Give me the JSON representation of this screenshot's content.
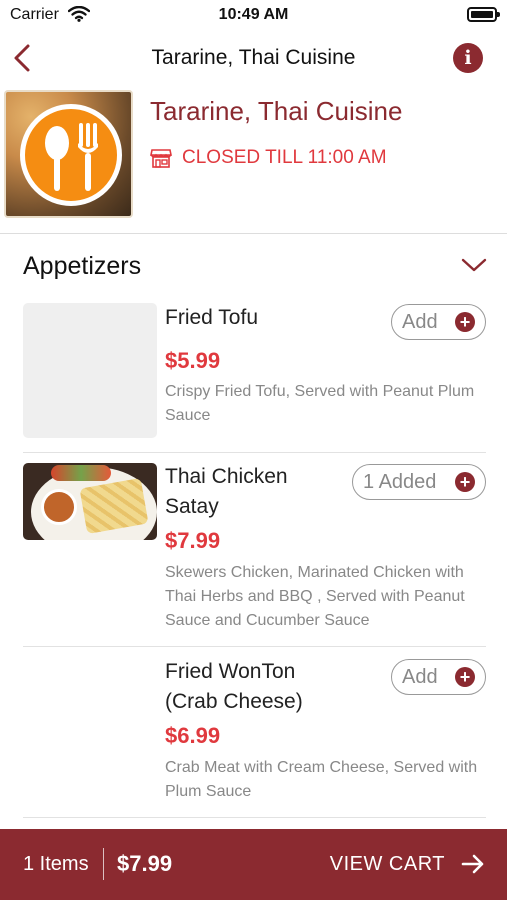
{
  "status_bar": {
    "carrier": "Carrier",
    "time": "10:49 AM"
  },
  "nav": {
    "title": "Tararine, Thai Cuisine"
  },
  "restaurant": {
    "name": "Tararine, Thai Cuisine",
    "status": "CLOSED TILL 11:00 AM"
  },
  "section": {
    "title": "Appetizers"
  },
  "items": [
    {
      "name": "Fried Tofu",
      "price": "$5.99",
      "description": "Crispy Fried Tofu, Served with Peanut Plum Sauce",
      "button": "Add"
    },
    {
      "name": "Thai Chicken Satay",
      "price": "$7.99",
      "description": "Skewers Chicken, Marinated Chicken with Thai Herbs and BBQ , Served with Peanut Sauce and Cucumber Sauce",
      "button": "1 Added"
    },
    {
      "name": "Fried WonTon (Crab Cheese)",
      "price": "$6.99",
      "description": "Crab Meat with Cream Cheese, Served with Plum Sauce",
      "button": "Add"
    }
  ],
  "cart": {
    "count": "1 Items",
    "total": "$7.99",
    "action": "VIEW CART"
  },
  "colors": {
    "brand": "#8b2a30",
    "accent": "#e0393e"
  },
  "icons": {
    "back": "chevron-left-icon",
    "info": "info-icon",
    "store": "store-icon",
    "collapse": "chevron-down-icon",
    "plus": "plus-circle-icon",
    "arrow": "arrow-right-icon"
  }
}
